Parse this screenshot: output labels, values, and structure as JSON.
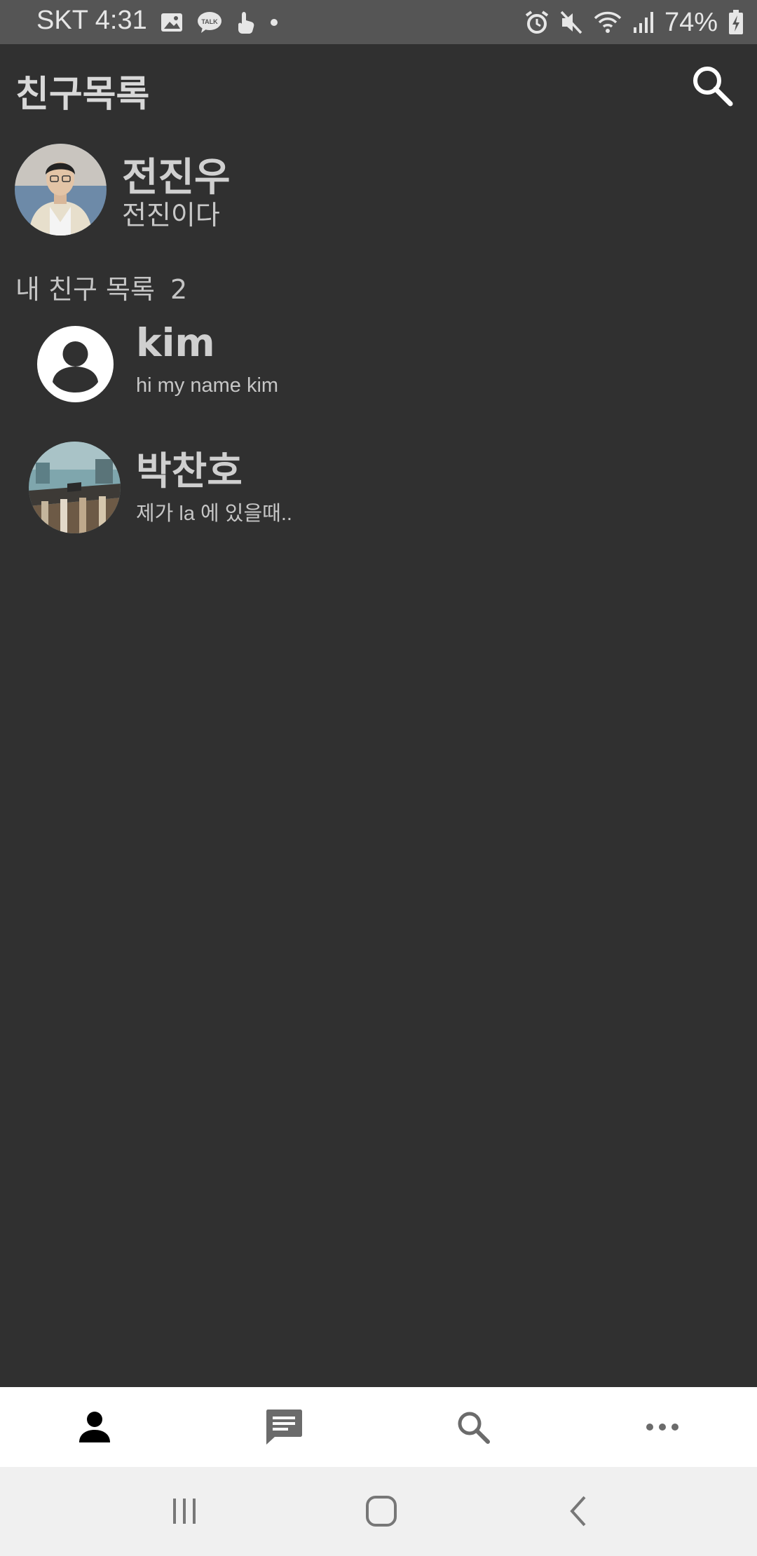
{
  "status_bar": {
    "carrier_time": "SKT 4:31",
    "battery": "74%",
    "icons_left": [
      "gallery-icon",
      "kakaotalk-icon",
      "hand-icon",
      "dot-icon"
    ],
    "icons_right": [
      "alarm-icon",
      "mute-icon",
      "wifi-icon",
      "signal-icon",
      "battery-charging-icon"
    ]
  },
  "header": {
    "title": "친구목록",
    "search_icon": "search-icon"
  },
  "my_profile": {
    "name": "전진우",
    "status": "전진이다"
  },
  "friends_section": {
    "label": "내 친구 목록",
    "count": "2"
  },
  "friends": [
    {
      "name": "kim",
      "message": "hi my name kim",
      "avatar": "default-person-icon"
    },
    {
      "name": "박찬호",
      "message": "제가 la 에 있을때..",
      "avatar": "photo"
    }
  ],
  "bottom_nav": [
    {
      "icon": "person-icon",
      "active": true
    },
    {
      "icon": "chat-icon",
      "active": false
    },
    {
      "icon": "search-icon",
      "active": false
    },
    {
      "icon": "more-icon",
      "active": false
    }
  ],
  "system_nav": [
    "recent-apps-icon",
    "home-icon",
    "back-icon"
  ],
  "colors": {
    "background": "#303030",
    "status_bar": "#555555",
    "bottom_nav": "#ffffff",
    "system_nav": "#f0f0f0"
  }
}
